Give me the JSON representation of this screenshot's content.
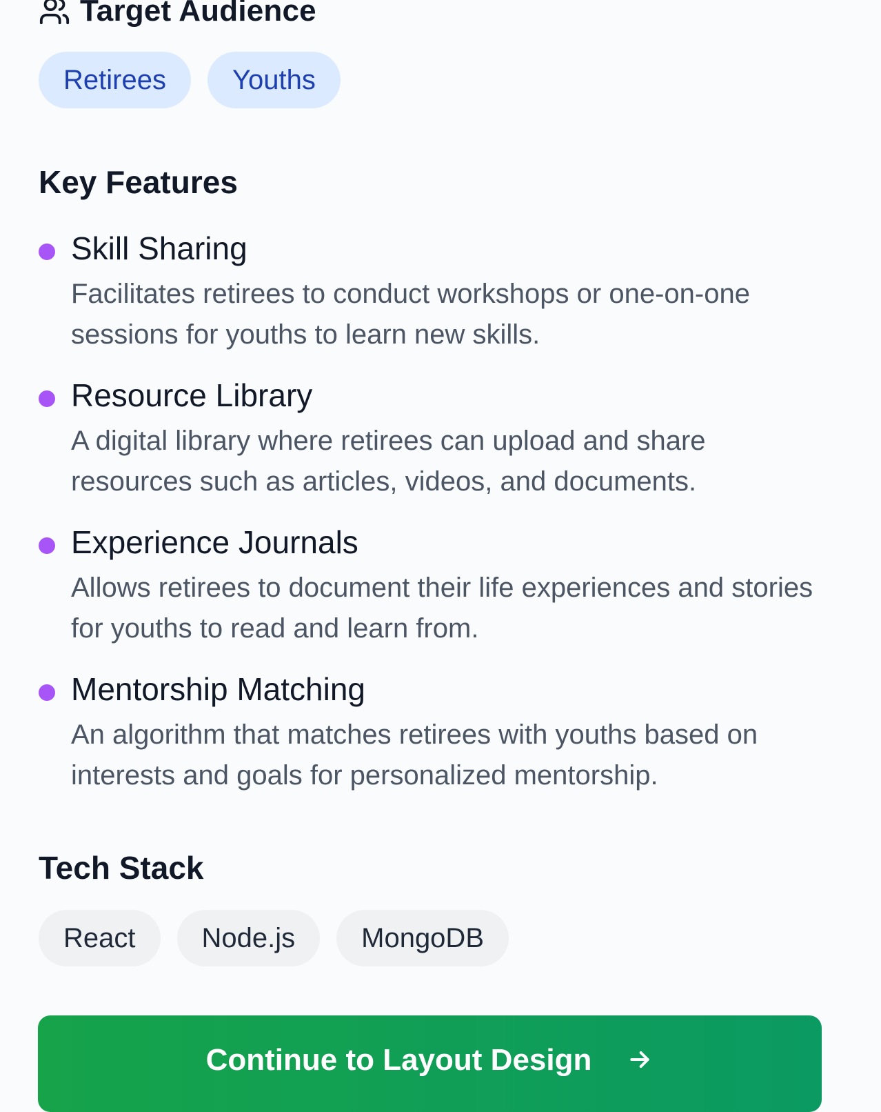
{
  "target_audience": {
    "title": "Target Audience",
    "icon": "users-icon",
    "tags": [
      "Retirees",
      "Youths"
    ]
  },
  "key_features": {
    "title": "Key Features",
    "items": [
      {
        "title": "Skill Sharing",
        "description": "Facilitates retirees to conduct workshops or one-on-one sessions for youths to learn new skills."
      },
      {
        "title": "Resource Library",
        "description": "A digital library where retirees can upload and share resources such as articles, videos, and documents."
      },
      {
        "title": "Experience Journals",
        "description": "Allows retirees to document their life experiences and stories for youths to read and learn from."
      },
      {
        "title": "Mentorship Matching",
        "description": "An algorithm that matches retirees with youths based on interests and goals for personalized mentorship."
      }
    ]
  },
  "tech_stack": {
    "title": "Tech Stack",
    "tags": [
      "React",
      "Node.js",
      "MongoDB"
    ]
  },
  "cta": {
    "label": "Continue to Layout Design",
    "icon": "arrow-right-icon"
  },
  "colors": {
    "bullet": "#a855f7",
    "audience_pill_bg": "#dbeafe",
    "audience_pill_text": "#1e40af",
    "tech_pill_bg": "#f0f1f3",
    "cta_start": "#16a34a",
    "cta_end": "#0b9a62"
  }
}
